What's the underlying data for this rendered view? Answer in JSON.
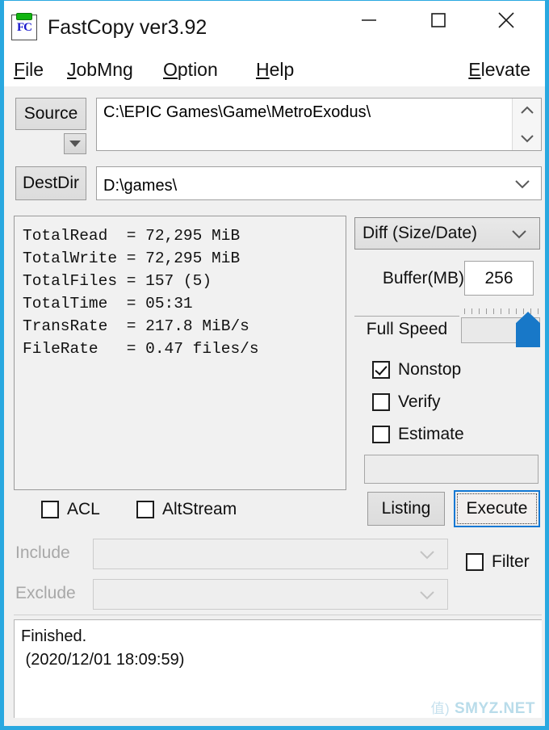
{
  "window": {
    "title": "FastCopy ver3.92",
    "icon_name": "fastcopy-clipboard-icon",
    "icon_letters": "FC",
    "border_color": "#29a8e0",
    "controls": {
      "minimize": "minimize-icon",
      "maximize": "maximize-icon",
      "close": "close-icon"
    }
  },
  "menubar": {
    "items": [
      {
        "label": "File",
        "accel": "F"
      },
      {
        "label": "JobMng",
        "accel": "J"
      },
      {
        "label": "Option",
        "accel": "O"
      },
      {
        "label": "Help",
        "accel": "H"
      }
    ],
    "right_item": {
      "label": "Elevate",
      "accel": "E"
    }
  },
  "paths": {
    "source_button": "Source",
    "source_value": "C:\\EPIC Games\\Game\\MetroExodus\\",
    "source_dropdown_icon": "triangle-down-icon",
    "source_scroll_up_icon": "chevron-up-icon",
    "source_scroll_down_icon": "chevron-down-icon",
    "dest_button": "DestDir",
    "dest_value": "D:\\games\\",
    "dest_dropdown_icon": "chevron-down-icon"
  },
  "stats": {
    "text": "TotalRead  = 72,295 MiB\nTotalWrite = 72,295 MiB\nTotalFiles = 157 (5)\nTotalTime  = 05:31\nTransRate  = 217.8 MiB/s\nFileRate   = 0.47 files/s",
    "rows": [
      {
        "label": "TotalRead",
        "value": "72,295 MiB"
      },
      {
        "label": "TotalWrite",
        "value": "72,295 MiB"
      },
      {
        "label": "TotalFiles",
        "value": "157 (5)"
      },
      {
        "label": "TotalTime",
        "value": "05:31"
      },
      {
        "label": "TransRate",
        "value": "217.8 MiB/s"
      },
      {
        "label": "FileRate",
        "value": "0.47 files/s"
      }
    ]
  },
  "options": {
    "mode_selected": "Diff (Size/Date)",
    "mode_chevron_icon": "chevron-down-icon",
    "buffer_label": "Buffer(MB)",
    "buffer_value": "256",
    "speed_label": "Full Speed",
    "speed_position_percent": 100,
    "checkboxes": [
      {
        "name": "nonstop",
        "label": "Nonstop",
        "checked": true
      },
      {
        "name": "verify",
        "label": "Verify",
        "checked": false
      },
      {
        "name": "estimate",
        "label": "Estimate",
        "checked": false
      }
    ],
    "progress_value": ""
  },
  "actions": {
    "listing_label": "Listing",
    "execute_label": "Execute",
    "execute_focused": true,
    "execute_border_color": "#1278d4"
  },
  "flags": {
    "acl": {
      "label": "ACL",
      "checked": false
    },
    "altstream": {
      "label": "AltStream",
      "checked": false
    },
    "filter": {
      "label": "Filter",
      "checked": false
    }
  },
  "filters": {
    "include_label": "Include",
    "include_value": "",
    "include_disabled": true,
    "exclude_label": "Exclude",
    "exclude_value": "",
    "exclude_disabled": true,
    "chevron_icon": "chevron-down-icon"
  },
  "log": {
    "text": "Finished.\n (2020/12/01 18:09:59)",
    "lines": [
      "Finished.",
      " (2020/12/01 18:09:59)"
    ]
  },
  "watermark": {
    "badge": "值)",
    "text": "SMYZ.NET"
  }
}
